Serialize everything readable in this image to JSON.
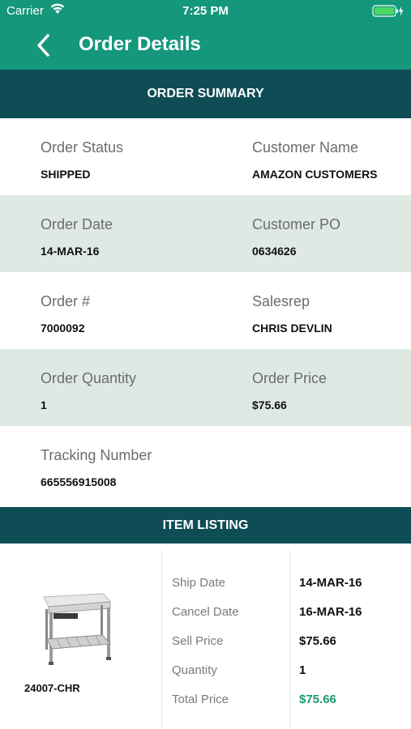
{
  "status_bar": {
    "carrier": "Carrier",
    "time": "7:25 PM"
  },
  "nav": {
    "title": "Order Details"
  },
  "summary": {
    "header": "ORDER SUMMARY",
    "order_status": {
      "label": "Order Status",
      "value": "SHIPPED"
    },
    "customer_name": {
      "label": "Customer Name",
      "value": "AMAZON CUSTOMERS"
    },
    "order_date": {
      "label": "Order Date",
      "value": "14-MAR-16"
    },
    "customer_po": {
      "label": "Customer PO",
      "value": "0634626"
    },
    "order_number": {
      "label": "Order #",
      "value": "7000092"
    },
    "salesrep": {
      "label": "Salesrep",
      "value": "CHRIS DEVLIN"
    },
    "order_quantity": {
      "label": "Order Quantity",
      "value": "1"
    },
    "order_price": {
      "label": "Order Price",
      "value": "$75.66"
    },
    "tracking_number": {
      "label": "Tracking Number",
      "value": "665556915008"
    }
  },
  "items": {
    "header": "ITEM LISTING",
    "list": [
      {
        "sku": "24007-CHR",
        "ship_date_label": "Ship Date",
        "ship_date": "14-MAR-16",
        "cancel_date_label": "Cancel Date",
        "cancel_date": "16-MAR-16",
        "sell_price_label": "Sell Price",
        "sell_price": "$75.66",
        "quantity_label": "Quantity",
        "quantity": "1",
        "total_price_label": "Total Price",
        "total_price": "$75.66"
      }
    ]
  },
  "colors": {
    "nav_green": "#14977b",
    "header_teal": "#0e4d55",
    "row_shade": "#dfe9e4",
    "total_green": "#1a9a74"
  }
}
